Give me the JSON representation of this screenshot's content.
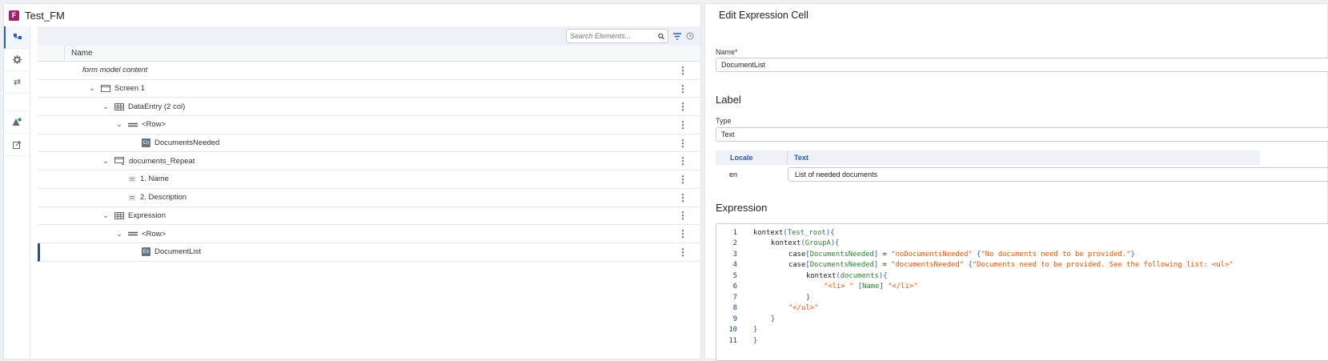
{
  "app": {
    "badge": "F",
    "title": "Test_FM"
  },
  "toolbar": {
    "search_placeholder": "Search Elements..."
  },
  "tree": {
    "column_name": "Name",
    "rows": [
      {
        "label": "form model content",
        "indent": 0,
        "chevron": false,
        "icon": "none",
        "italic": true
      },
      {
        "label": "Screen 1",
        "indent": 1,
        "chevron": true,
        "icon": "screen-icon"
      },
      {
        "label": "DataEntry (2 col)",
        "indent": 2,
        "chevron": true,
        "icon": "grid-icon"
      },
      {
        "label": "<Row>",
        "indent": 3,
        "chevron": true,
        "icon": "row-icon"
      },
      {
        "label": "DocumentsNeeded",
        "indent": 4,
        "chevron": false,
        "icon": "badge",
        "badge": "Cn"
      },
      {
        "label": "documents_Repeat",
        "indent": 2,
        "chevron": true,
        "icon": "repeat-icon"
      },
      {
        "label": "1. Name",
        "indent": 3,
        "chevron": false,
        "icon": "list-icon"
      },
      {
        "label": "2. Description",
        "indent": 3,
        "chevron": false,
        "icon": "list-icon"
      },
      {
        "label": "Expression",
        "indent": 2,
        "chevron": true,
        "icon": "grid-icon"
      },
      {
        "label": "<Row>",
        "indent": 3,
        "chevron": true,
        "icon": "row-icon"
      },
      {
        "label": "DocumentList",
        "indent": 4,
        "chevron": false,
        "icon": "badge",
        "badge": "Ex",
        "selected": true
      }
    ]
  },
  "editor": {
    "title": "Edit Expression Cell",
    "name_label": "Name*",
    "name_value": "DocumentList",
    "label_section": "Label",
    "type_label": "Type",
    "type_value": "Text",
    "locale_header": "Locale",
    "text_header": "Text",
    "locale_value": "en",
    "text_value": "List of needed documents",
    "expression_section": "Expression",
    "code": [
      {
        "n": "1",
        "indent": 0,
        "tokens": [
          [
            "kw",
            "kontext"
          ],
          [
            "br",
            "("
          ],
          [
            "fld",
            "Test_root"
          ],
          [
            "br",
            ")"
          ],
          [
            "br",
            "{"
          ]
        ]
      },
      {
        "n": "2",
        "indent": 1,
        "tokens": [
          [
            "kw",
            "kontext"
          ],
          [
            "br",
            "("
          ],
          [
            "fld",
            "GroupA"
          ],
          [
            "br",
            ")"
          ],
          [
            "br",
            "{"
          ]
        ]
      },
      {
        "n": "3",
        "indent": 2,
        "tokens": [
          [
            "kw",
            "case"
          ],
          [
            "br",
            "["
          ],
          [
            "fld",
            "DocumentsNeeded"
          ],
          [
            "br",
            "]"
          ],
          [
            "op",
            " = "
          ],
          [
            "str",
            "\"noDocumentsNeeded\""
          ],
          [
            "op",
            " "
          ],
          [
            "br",
            "{"
          ],
          [
            "str",
            "\"No documents need to be provided.\""
          ],
          [
            "br",
            "}"
          ]
        ]
      },
      {
        "n": "4",
        "indent": 2,
        "tokens": [
          [
            "kw",
            "case"
          ],
          [
            "br",
            "["
          ],
          [
            "fld",
            "DocumentsNeeded"
          ],
          [
            "br",
            "]"
          ],
          [
            "op",
            " = "
          ],
          [
            "str",
            "\"documentsNeeded\""
          ],
          [
            "op",
            " "
          ],
          [
            "br",
            "{"
          ],
          [
            "str",
            "\"Documents need to be provided. See the following list: <ul>\""
          ]
        ]
      },
      {
        "n": "5",
        "indent": 3,
        "tokens": [
          [
            "kw",
            "kontext"
          ],
          [
            "br",
            "("
          ],
          [
            "fld",
            "documents"
          ],
          [
            "br",
            ")"
          ],
          [
            "br",
            "{"
          ]
        ]
      },
      {
        "n": "6",
        "indent": 4,
        "tokens": [
          [
            "str",
            "\"<li> \""
          ],
          [
            "op",
            " "
          ],
          [
            "br",
            "["
          ],
          [
            "fld",
            "Name"
          ],
          [
            "br",
            "]"
          ],
          [
            "op",
            " "
          ],
          [
            "str",
            "\"</li>\""
          ]
        ]
      },
      {
        "n": "7",
        "indent": 3,
        "tokens": [
          [
            "br",
            "}"
          ]
        ]
      },
      {
        "n": "8",
        "indent": 2,
        "tokens": [
          [
            "str",
            "\"</ul>\""
          ]
        ]
      },
      {
        "n": "9",
        "indent": 1,
        "tokens": [
          [
            "br",
            "}"
          ]
        ]
      },
      {
        "n": "10",
        "indent": 0,
        "tokens": [
          [
            "br",
            "}"
          ]
        ]
      },
      {
        "n": "11",
        "indent": 0,
        "tokens": [
          [
            "br",
            "}"
          ]
        ]
      }
    ]
  }
}
